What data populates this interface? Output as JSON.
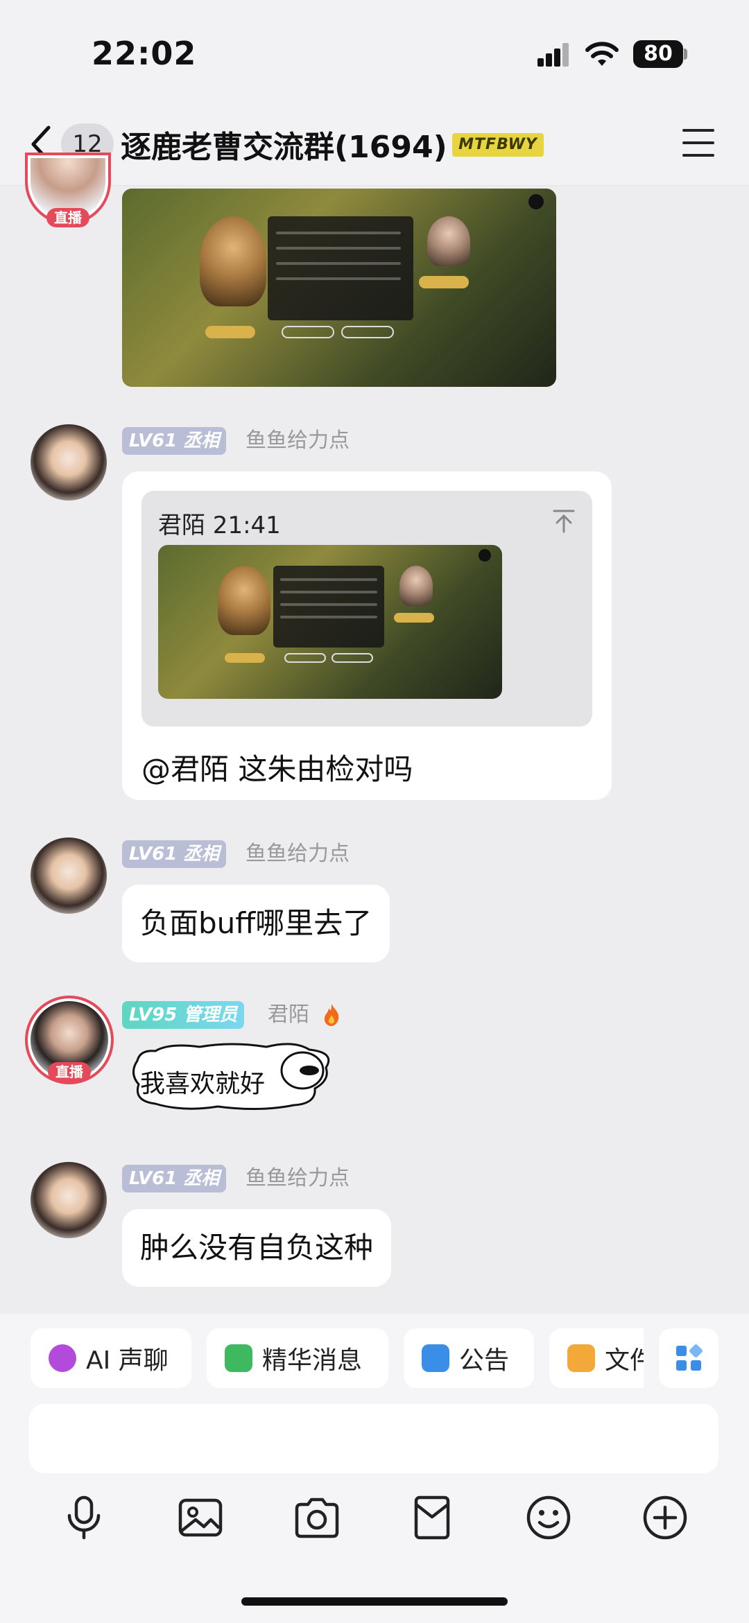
{
  "status": {
    "time": "22:02",
    "battery": "80"
  },
  "header": {
    "unread": "12",
    "title": "逐鹿老曹交流群(1694)",
    "badge": "MTFBWY"
  },
  "messages": [
    {
      "level": "LV61",
      "title": "丞相",
      "name": "鱼鱼给力点"
    },
    {
      "level": "LV61",
      "title": "丞相",
      "name": "鱼鱼给力点",
      "text": "负面buff哪里去了"
    },
    {
      "level": "LV95",
      "title": "管理员",
      "name": "君陌",
      "sticker_text": "我喜欢就好"
    },
    {
      "level": "LV61",
      "title": "丞相",
      "name": "鱼鱼给力点",
      "text": "肿么没有自负这种"
    }
  ],
  "quote": {
    "author_time": "君陌 21:41",
    "reply": "@君陌 这朱由检对吗"
  },
  "live_label": "直播",
  "shortcuts": [
    "AI 声聊",
    "精华消息",
    "公告",
    "文件"
  ],
  "colors": {
    "accent": "#e54a5a",
    "level_badge": "#b9bed6",
    "admin_badge": "#5fd6c0"
  }
}
